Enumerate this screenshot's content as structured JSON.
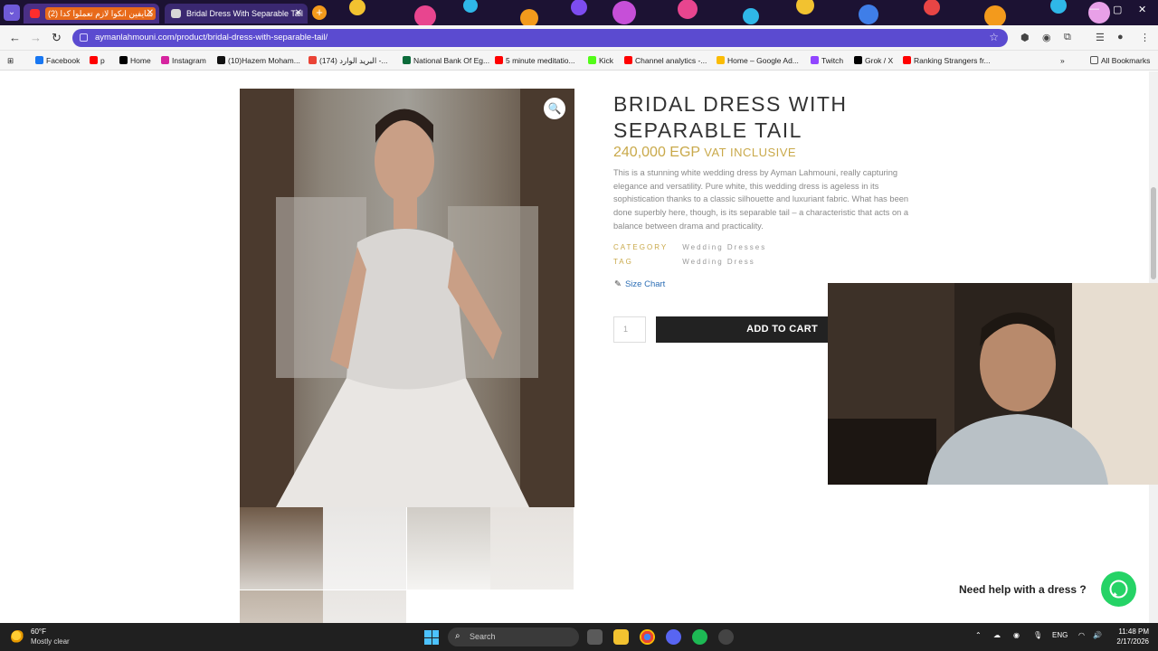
{
  "browser": {
    "tabs": [
      {
        "title": "(2) شايفين انكوا لازم تعملوا كدا",
        "active": false
      },
      {
        "title": "Bridal Dress With Separable Tail",
        "active": true
      }
    ],
    "new_tab_label": "+",
    "url": "aymanlahmouni.com/product/bridal-dress-with-separable-tail/",
    "bookmarks": [
      "Facebook",
      "p",
      "Home",
      "Instagram",
      "(10)Hazem Moham...",
      "(174) البريد الوارد -...",
      "National Bank Of Eg...",
      "5 minute meditatio...",
      "Kick",
      "Channel analytics -...",
      "Home – Google Ad...",
      "Twitch",
      "Grok / X",
      "Ranking Strangers fr...",
      "All Bookmarks"
    ]
  },
  "product": {
    "title": "BRIDAL DRESS WITH SEPARABLE TAIL",
    "price": "240,000 EGP",
    "vat": "VAT INCLUSIVE",
    "description": "This is a stunning white wedding dress by Ayman Lahmouni, really capturing elegance and versatility. Pure white, this wedding dress is ageless in its sophistication thanks to a classic silhouette and luxuriant fabric. What has been done superbly here, though, is its separable tail – a characteristic that acts on a balance between drama and practicality.",
    "category_label": "CATEGORY",
    "category_value": "Wedding Dresses",
    "tag_label": "TAG",
    "tag_value": "Wedding Dress",
    "size_chart": "Size Chart",
    "quantity": "1",
    "add_to_cart": "ADD TO CART"
  },
  "help": {
    "text": "Need help with a dress ?"
  },
  "taskbar": {
    "temperature": "60°F",
    "condition": "Mostly clear",
    "search_placeholder": "Search",
    "language": "ENG",
    "time": "11:48 PM",
    "date": "2/17/2026"
  },
  "colors": {
    "accent_gold": "#c9a94a",
    "omnibox": "#5b4bd0",
    "whatsapp": "#25d366"
  }
}
